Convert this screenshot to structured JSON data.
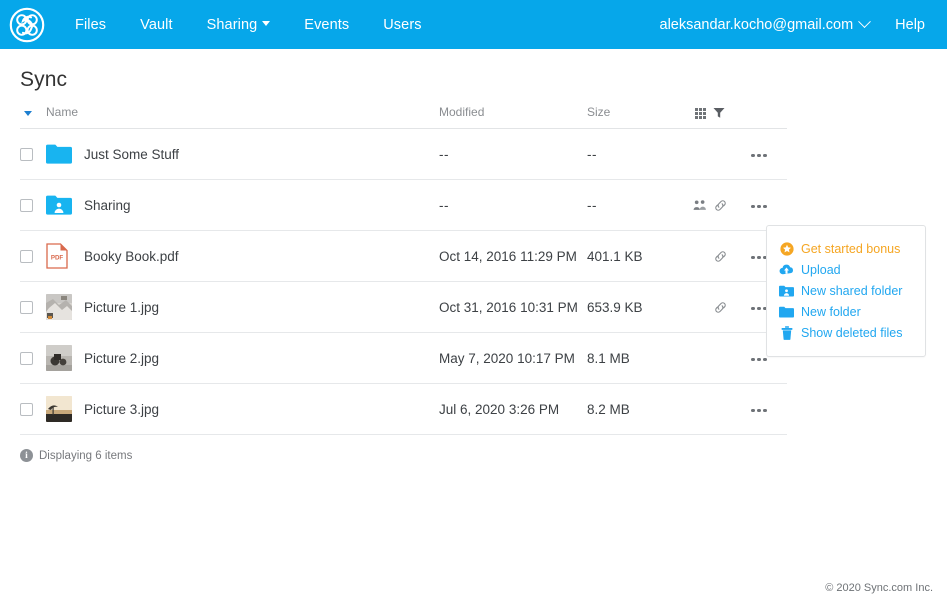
{
  "header": {
    "logo_name": "sync-logo",
    "nav": [
      {
        "label": "Files",
        "name": "nav-files",
        "dropdown": false
      },
      {
        "label": "Vault",
        "name": "nav-vault",
        "dropdown": false
      },
      {
        "label": "Sharing",
        "name": "nav-sharing",
        "dropdown": true
      },
      {
        "label": "Events",
        "name": "nav-events",
        "dropdown": false
      },
      {
        "label": "Users",
        "name": "nav-users",
        "dropdown": false
      }
    ],
    "account_email": "aleksandar.kocho@gmail.com",
    "help_label": "Help",
    "background_color": "#06A7EA"
  },
  "page": {
    "title": "Sync"
  },
  "table": {
    "columns": {
      "name": "Name",
      "modified": "Modified",
      "size": "Size"
    },
    "view_icons": [
      {
        "name": "grid-view-icon"
      },
      {
        "name": "filter-icon"
      }
    ],
    "sort_indicator": "descending",
    "rows": [
      {
        "name": "Just Some Stuff",
        "icon": "folder-icon",
        "modified": "--",
        "size": "--",
        "shared": false,
        "linked": false
      },
      {
        "name": "Sharing",
        "icon": "shared-folder-icon",
        "modified": "--",
        "size": "--",
        "shared": true,
        "linked": true
      },
      {
        "name": "Booky Book.pdf",
        "icon": "pdf-file-icon",
        "modified": "Oct 14, 2016 11:29 PM",
        "size": "401.1 KB",
        "shared": false,
        "linked": true
      },
      {
        "name": "Picture 1.jpg",
        "icon": "image-thumbnail",
        "modified": "Oct 31, 2016 10:31 PM",
        "size": "653.9 KB",
        "shared": false,
        "linked": true
      },
      {
        "name": "Picture 2.jpg",
        "icon": "image-thumbnail",
        "modified": "May 7, 2020 10:17 PM",
        "size": "8.1 MB",
        "shared": false,
        "linked": false
      },
      {
        "name": "Picture 3.jpg",
        "icon": "image-thumbnail",
        "modified": "Jul 6, 2020 3:26 PM",
        "size": "8.2 MB",
        "shared": false,
        "linked": false
      }
    ]
  },
  "status": {
    "displaying": "Displaying 6 items"
  },
  "action_panel": {
    "items": [
      {
        "label": "Get started bonus",
        "icon": "star-bonus-icon",
        "color": "#F5A623"
      },
      {
        "label": "Upload",
        "icon": "upload-cloud-icon",
        "color": "#21A7F0"
      },
      {
        "label": "New shared folder",
        "icon": "shared-folder-icon",
        "color": "#21A7F0"
      },
      {
        "label": "New folder",
        "icon": "folder-icon",
        "color": "#21A7F0"
      },
      {
        "label": "Show deleted files",
        "icon": "trash-icon",
        "color": "#21A7F0"
      }
    ]
  },
  "footer": {
    "copyright": "© 2020 Sync.com Inc."
  }
}
